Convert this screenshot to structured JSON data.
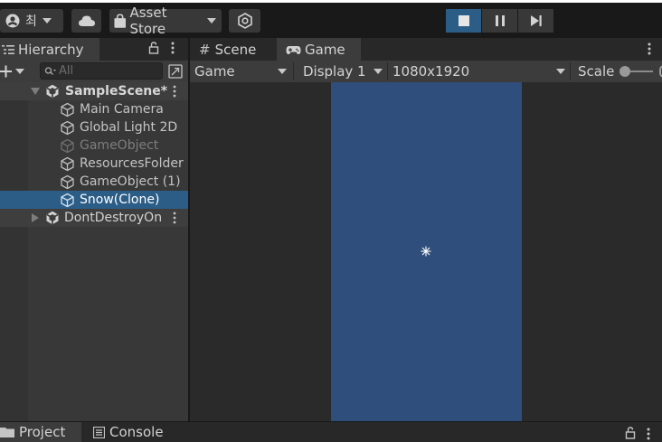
{
  "toolbar": {
    "account_initial": "최",
    "asset_store_label": "Asset Store"
  },
  "hierarchy": {
    "tab_label": "Hierarchy",
    "search_placeholder": "All",
    "items": [
      {
        "label": "SampleScene*",
        "type": "scene",
        "expanded": true
      },
      {
        "label": "Main Camera",
        "type": "gameobject"
      },
      {
        "label": "Global Light 2D",
        "type": "gameobject"
      },
      {
        "label": "GameObject",
        "type": "gameobject",
        "inactive": true
      },
      {
        "label": "ResourcesFolder",
        "type": "gameobject"
      },
      {
        "label": "GameObject (1)",
        "type": "gameobject"
      },
      {
        "label": "Snow(Clone)",
        "type": "gameobject",
        "selected": true
      },
      {
        "label": "DontDestroyOn",
        "type": "scene",
        "expanded": false
      }
    ]
  },
  "game_view": {
    "tabs": [
      "Scene",
      "Game"
    ],
    "active_tab": "Game",
    "view_dropdown": "Game",
    "display_dropdown": "Display 1",
    "resolution_dropdown": "1080x1920",
    "scale_label": "Scale",
    "background_color": "#2a2a2a",
    "canvas_color": "#2f4e7c"
  },
  "bottom": {
    "tabs": [
      "Project",
      "Console"
    ]
  },
  "colors": {
    "selection": "#2c5d87",
    "play_active": "#2c5d87"
  }
}
